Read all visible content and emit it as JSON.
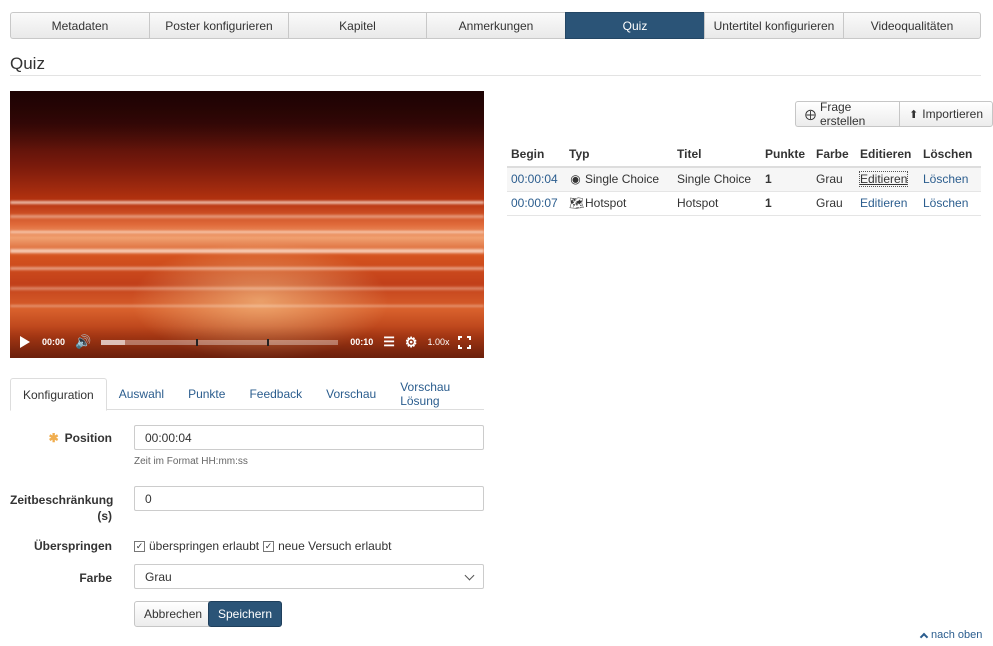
{
  "top_tabs": [
    {
      "label": "Metadaten",
      "active": false
    },
    {
      "label": "Poster konfigurieren",
      "active": false
    },
    {
      "label": "Kapitel",
      "active": false
    },
    {
      "label": "Anmerkungen",
      "active": false
    },
    {
      "label": "Quiz",
      "active": true
    },
    {
      "label": "Untertitel konfigurieren",
      "active": false
    },
    {
      "label": "Videoqualitäten",
      "active": false
    }
  ],
  "page_title": "Quiz",
  "video": {
    "current_time": "00:00",
    "end_time": "00:10",
    "speed": "1.00x",
    "progress_buffered": 0.1,
    "markers": [
      0.4,
      0.7
    ]
  },
  "actions": {
    "create_label": "Frage erstellen",
    "import_label": "Importieren"
  },
  "table": {
    "headers": [
      "Begin",
      "Typ",
      "Titel",
      "Punkte",
      "Farbe",
      "Editieren",
      "Löschen"
    ],
    "rows": [
      {
        "begin": "00:00:04",
        "typ_icon": "radio-target-icon",
        "typ": "Single Choice",
        "titel": "Single Choice",
        "punkte": "1",
        "farbe": "Grau",
        "edit": "Editieren",
        "delete": "Löschen"
      },
      {
        "begin": "00:00:07",
        "typ_icon": "map-icon",
        "typ": "Hotspot",
        "titel": "Hotspot",
        "punkte": "1",
        "farbe": "Grau",
        "edit": "Editieren",
        "delete": "Löschen"
      }
    ]
  },
  "sub_tabs": [
    {
      "label": "Konfiguration",
      "active": true
    },
    {
      "label": "Auswahl",
      "active": false
    },
    {
      "label": "Punkte",
      "active": false
    },
    {
      "label": "Feedback",
      "active": false
    },
    {
      "label": "Vorschau",
      "active": false
    },
    {
      "label": "Vorschau Lösung",
      "active": false
    }
  ],
  "form": {
    "position_label": "Position",
    "position_value": "00:00:04",
    "position_help": "Zeit im Format HH:mm:ss",
    "limit_label_1": "Zeitbeschränkung",
    "limit_label_2": "(s)",
    "limit_value": "0",
    "skip_label": "Überspringen",
    "skip_allowed_label": "überspringen erlaubt",
    "retry_allowed_label": "neue Versuch erlaubt",
    "color_label": "Farbe",
    "color_value": "Grau",
    "cancel_label": "Abbrechen",
    "save_label": "Speichern"
  },
  "to_top_label": "nach oben",
  "colors": {
    "accent": "#2b5477",
    "link": "#2b5d8e",
    "required": "#f0ad4e"
  }
}
